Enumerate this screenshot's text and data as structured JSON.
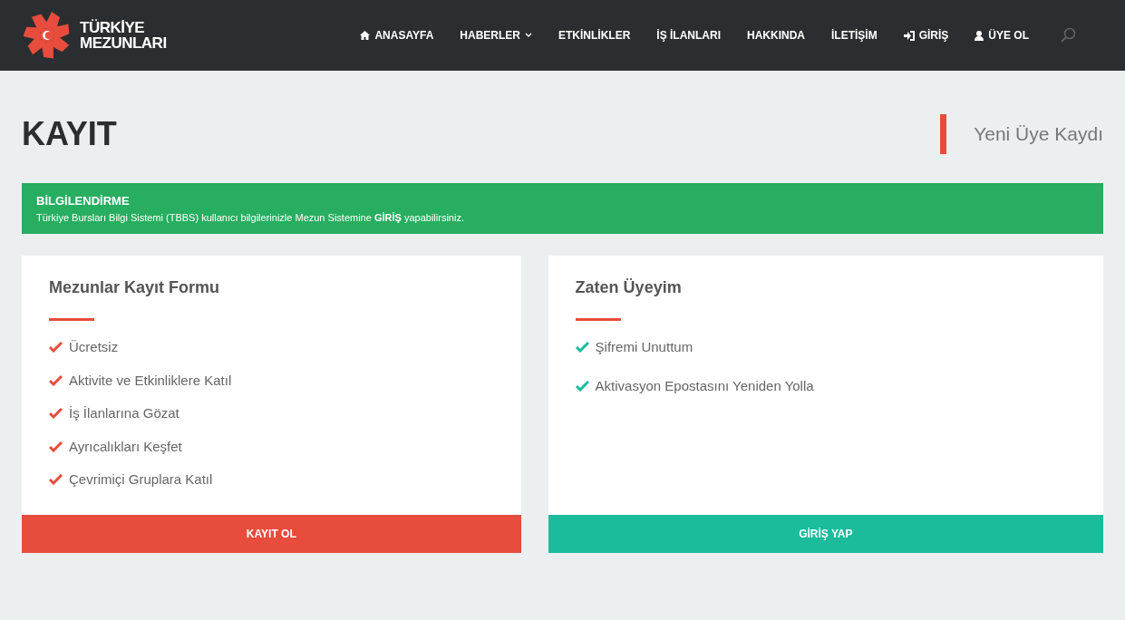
{
  "logo": {
    "line1": "TÜRKİYE",
    "line2": "MEZUNLARI"
  },
  "nav": [
    {
      "label": "ANASAYFA",
      "kind": "home",
      "dropdown": false
    },
    {
      "label": "HABERLER",
      "kind": "plain",
      "dropdown": true
    },
    {
      "label": "ETKİNLİKLER",
      "kind": "plain",
      "dropdown": false
    },
    {
      "label": "İŞ İLANLARI",
      "kind": "plain",
      "dropdown": false
    },
    {
      "label": "HAKKINDA",
      "kind": "plain",
      "dropdown": false
    },
    {
      "label": "İLETİŞİM",
      "kind": "plain",
      "dropdown": false
    },
    {
      "label": "GİRİŞ",
      "kind": "login",
      "dropdown": false
    },
    {
      "label": "ÜYE OL",
      "kind": "user",
      "dropdown": false
    }
  ],
  "page": {
    "title": "KAYIT",
    "subtitle": "Yeni Üye Kaydı"
  },
  "alert": {
    "title": "BİLGİLENDİRME",
    "text": "Türkiye Bursları Bilgi Sistemi (TBBS) kullanıcı bilgilerinizle Mezun Sistemine **GİRİŞ** yapabilirsiniz."
  },
  "cards": [
    {
      "title": "Mezunlar Kayıt Formu",
      "color": "#e74c3c",
      "items": [
        "Ücretsiz",
        "Aktivite ve Etkinliklere Katıl",
        "İş İlanlarına Gözat",
        "Ayrıcalıkları Keşfet",
        "Çevrimiçi Gruplara Katıl"
      ],
      "button": "KAYIT OL"
    },
    {
      "title": "Zaten Üyeyim",
      "color": "#1abc9c",
      "items": [
        "Şifremi Unuttum",
        "Aktivasyon Epostasını Yeniden Yolla"
      ],
      "button": "GİRİŞ YAP"
    }
  ]
}
